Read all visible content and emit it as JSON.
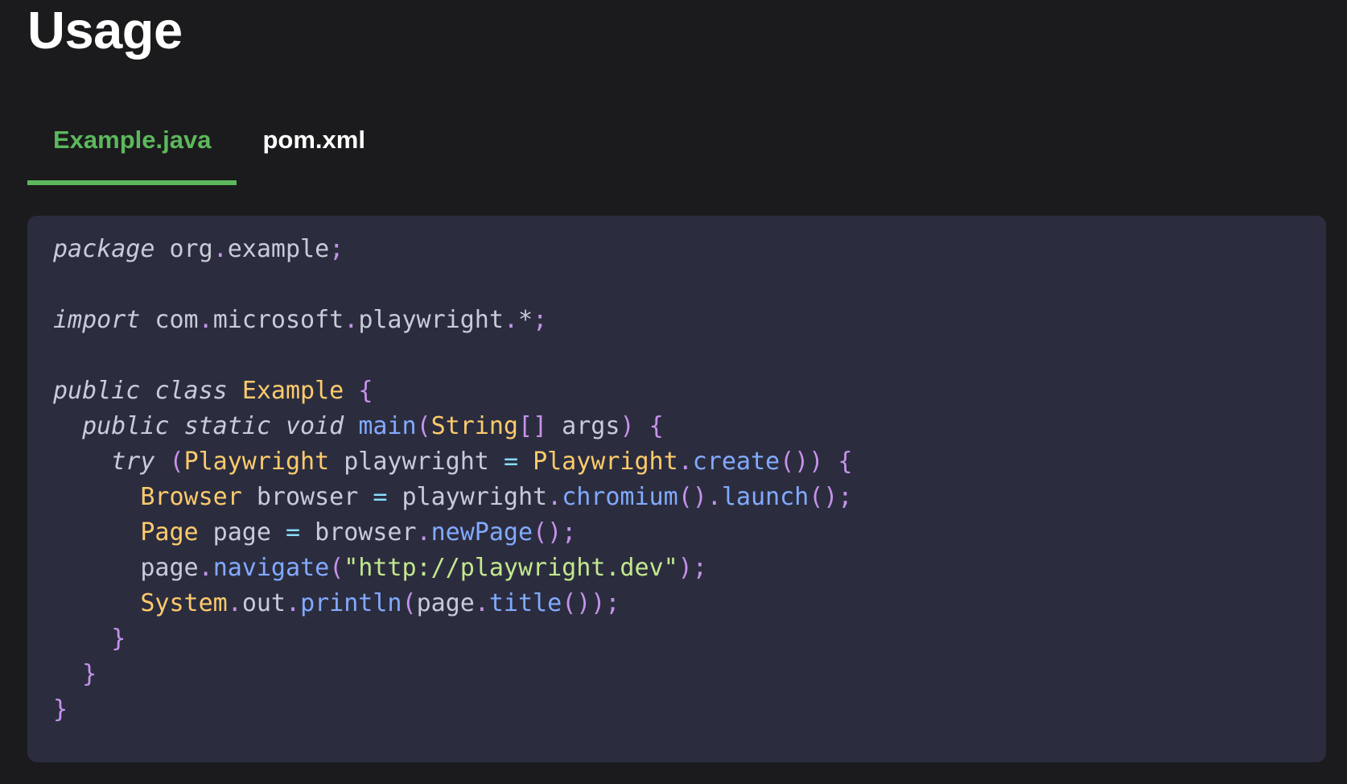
{
  "heading": "Usage",
  "tabs": [
    {
      "label": "Example.java",
      "active": true
    },
    {
      "label": "pom.xml",
      "active": false
    }
  ],
  "colors": {
    "background": "#1b1b1d",
    "code_background": "#2b2d3f",
    "accent": "#5cb85c",
    "keyword": "#c8cbd8",
    "type": "#ffcb6b",
    "function": "#82aaff",
    "punctuation": "#c792ea",
    "operator": "#89ddff",
    "string": "#c3e88d"
  },
  "code": {
    "language": "java",
    "lines": [
      [
        {
          "t": "kw",
          "v": "package"
        },
        {
          "t": "id",
          "v": " org"
        },
        {
          "t": "pu",
          "v": "."
        },
        {
          "t": "id",
          "v": "example"
        },
        {
          "t": "pu",
          "v": ";"
        }
      ],
      [],
      [
        {
          "t": "kw",
          "v": "import"
        },
        {
          "t": "id",
          "v": " com"
        },
        {
          "t": "pu",
          "v": "."
        },
        {
          "t": "id",
          "v": "microsoft"
        },
        {
          "t": "pu",
          "v": "."
        },
        {
          "t": "id",
          "v": "playwright"
        },
        {
          "t": "pu",
          "v": "."
        },
        {
          "t": "id",
          "v": "*"
        },
        {
          "t": "pu",
          "v": ";"
        }
      ],
      [],
      [
        {
          "t": "kw",
          "v": "public"
        },
        {
          "t": "id",
          "v": " "
        },
        {
          "t": "kw",
          "v": "class"
        },
        {
          "t": "id",
          "v": " "
        },
        {
          "t": "ty",
          "v": "Example"
        },
        {
          "t": "id",
          "v": " "
        },
        {
          "t": "pu",
          "v": "{"
        }
      ],
      [
        {
          "t": "id",
          "v": "  "
        },
        {
          "t": "kw",
          "v": "public"
        },
        {
          "t": "id",
          "v": " "
        },
        {
          "t": "kw",
          "v": "static"
        },
        {
          "t": "id",
          "v": " "
        },
        {
          "t": "kw",
          "v": "void"
        },
        {
          "t": "id",
          "v": " "
        },
        {
          "t": "fn",
          "v": "main"
        },
        {
          "t": "pu",
          "v": "("
        },
        {
          "t": "ty",
          "v": "String"
        },
        {
          "t": "pu",
          "v": "[]"
        },
        {
          "t": "id",
          "v": " args"
        },
        {
          "t": "pu",
          "v": ")"
        },
        {
          "t": "id",
          "v": " "
        },
        {
          "t": "pu",
          "v": "{"
        }
      ],
      [
        {
          "t": "id",
          "v": "    "
        },
        {
          "t": "kw",
          "v": "try"
        },
        {
          "t": "id",
          "v": " "
        },
        {
          "t": "pu",
          "v": "("
        },
        {
          "t": "ty",
          "v": "Playwright"
        },
        {
          "t": "id",
          "v": " playwright "
        },
        {
          "t": "op",
          "v": "="
        },
        {
          "t": "id",
          "v": " "
        },
        {
          "t": "ty",
          "v": "Playwright"
        },
        {
          "t": "pu",
          "v": "."
        },
        {
          "t": "fn",
          "v": "create"
        },
        {
          "t": "pu",
          "v": "())"
        },
        {
          "t": "id",
          "v": " "
        },
        {
          "t": "pu",
          "v": "{"
        }
      ],
      [
        {
          "t": "id",
          "v": "      "
        },
        {
          "t": "ty",
          "v": "Browser"
        },
        {
          "t": "id",
          "v": " browser "
        },
        {
          "t": "op",
          "v": "="
        },
        {
          "t": "id",
          "v": " playwright"
        },
        {
          "t": "pu",
          "v": "."
        },
        {
          "t": "fn",
          "v": "chromium"
        },
        {
          "t": "pu",
          "v": "()."
        },
        {
          "t": "fn",
          "v": "launch"
        },
        {
          "t": "pu",
          "v": "();"
        }
      ],
      [
        {
          "t": "id",
          "v": "      "
        },
        {
          "t": "ty",
          "v": "Page"
        },
        {
          "t": "id",
          "v": " page "
        },
        {
          "t": "op",
          "v": "="
        },
        {
          "t": "id",
          "v": " browser"
        },
        {
          "t": "pu",
          "v": "."
        },
        {
          "t": "fn",
          "v": "newPage"
        },
        {
          "t": "pu",
          "v": "();"
        }
      ],
      [
        {
          "t": "id",
          "v": "      page"
        },
        {
          "t": "pu",
          "v": "."
        },
        {
          "t": "fn",
          "v": "navigate"
        },
        {
          "t": "pu",
          "v": "("
        },
        {
          "t": "st",
          "v": "\"http://playwright.dev\""
        },
        {
          "t": "pu",
          "v": ");"
        }
      ],
      [
        {
          "t": "id",
          "v": "      "
        },
        {
          "t": "ty",
          "v": "System"
        },
        {
          "t": "pu",
          "v": "."
        },
        {
          "t": "id",
          "v": "out"
        },
        {
          "t": "pu",
          "v": "."
        },
        {
          "t": "fn",
          "v": "println"
        },
        {
          "t": "pu",
          "v": "("
        },
        {
          "t": "id",
          "v": "page"
        },
        {
          "t": "pu",
          "v": "."
        },
        {
          "t": "fn",
          "v": "title"
        },
        {
          "t": "pu",
          "v": "());"
        }
      ],
      [
        {
          "t": "id",
          "v": "    "
        },
        {
          "t": "pu",
          "v": "}"
        }
      ],
      [
        {
          "t": "id",
          "v": "  "
        },
        {
          "t": "pu",
          "v": "}"
        }
      ],
      [
        {
          "t": "pu",
          "v": "}"
        }
      ]
    ]
  }
}
